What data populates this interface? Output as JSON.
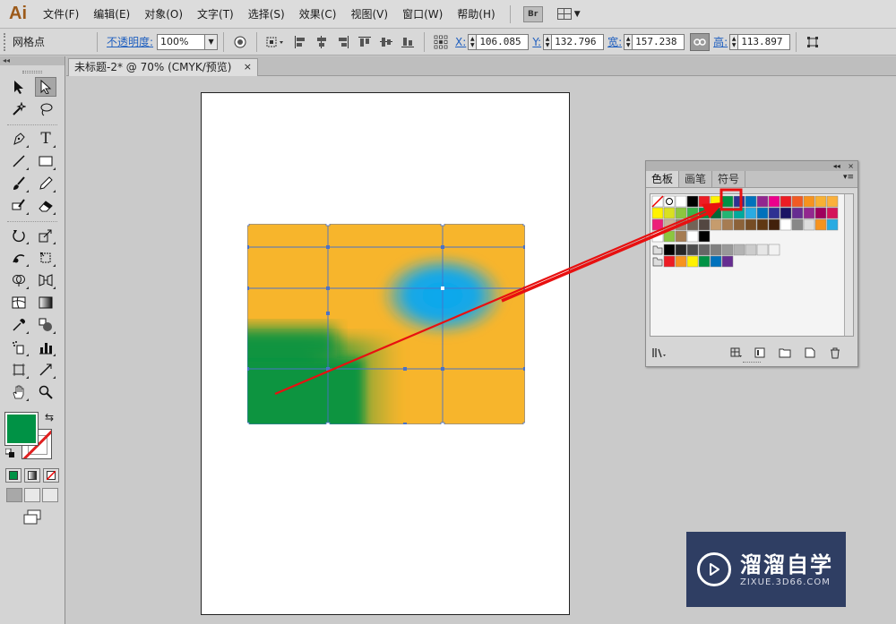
{
  "app": {
    "logo": "Ai"
  },
  "menu": [
    "文件(F)",
    "编辑(E)",
    "对象(O)",
    "文字(T)",
    "选择(S)",
    "效果(C)",
    "视图(V)",
    "窗口(W)",
    "帮助(H)"
  ],
  "menu_extra": {
    "bridge": "Br"
  },
  "control_bar": {
    "selection_label": "网格点",
    "opacity_label": "不透明度:",
    "opacity_value": "100%",
    "x_label": "X:",
    "x_value": "106.085",
    "y_label": "Y:",
    "y_value": "132.796",
    "w_label": "宽:",
    "w_value": "157.238",
    "h_label": "高:",
    "h_value": "113.897"
  },
  "tools_panel": {
    "collapse": "◂◂"
  },
  "document": {
    "tab_title": "未标题-2* @ 70% (CMYK/预览)",
    "close": "×"
  },
  "swatches_panel": {
    "collapse": "◂◂",
    "close": "×",
    "tabs": [
      "色板",
      "画笔",
      "符号"
    ],
    "active_tab": "色板"
  },
  "colors": {
    "fill": "#009245",
    "accent_red": "#e81010",
    "mesh_orange": "#f7b52c",
    "mesh_blue": "#12a6e6",
    "mesh_green": "#0a9440"
  },
  "watermark": {
    "title": "溜溜自学",
    "subtitle": "ZIXUE.3D66.COM"
  }
}
